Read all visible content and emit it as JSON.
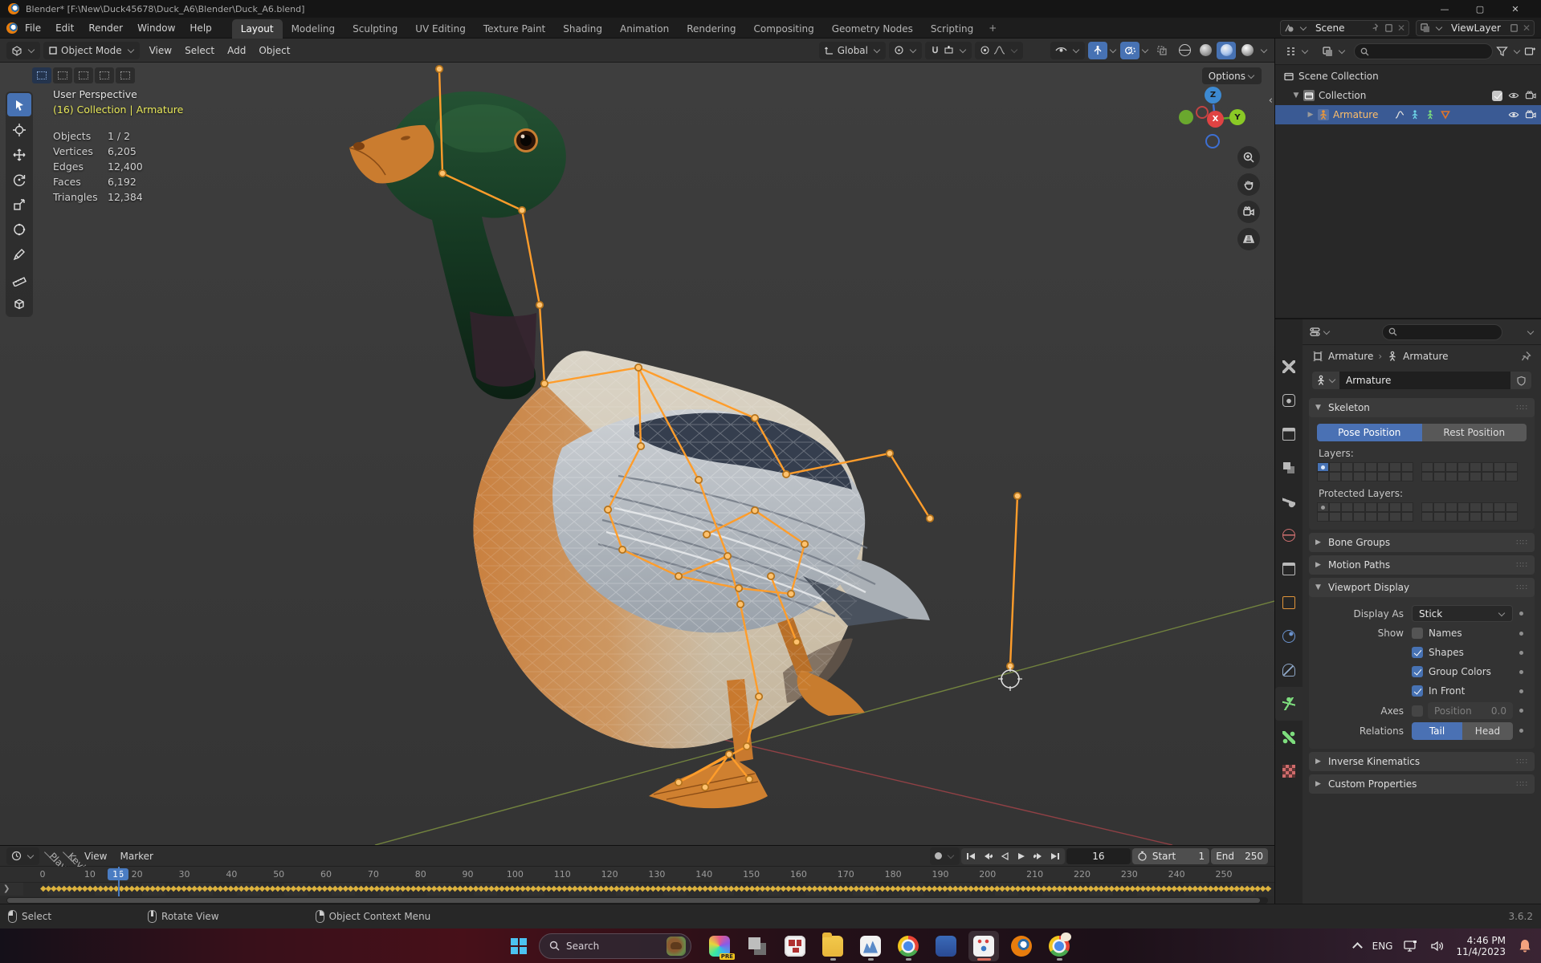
{
  "window": {
    "title": "Blender* [F:\\New\\Duck45678\\Duck_A6\\Blender\\Duck_A6.blend]",
    "minimize": "—",
    "maximize": "▢",
    "close": "✕"
  },
  "topbar": {
    "menus": [
      {
        "label": "File"
      },
      {
        "label": "Edit"
      },
      {
        "label": "Render"
      },
      {
        "label": "Window"
      },
      {
        "label": "Help"
      }
    ],
    "workspaces": [
      {
        "label": "Layout",
        "active": true
      },
      {
        "label": "Modeling"
      },
      {
        "label": "Sculpting"
      },
      {
        "label": "UV Editing"
      },
      {
        "label": "Texture Paint"
      },
      {
        "label": "Shading"
      },
      {
        "label": "Animation"
      },
      {
        "label": "Rendering"
      },
      {
        "label": "Compositing"
      },
      {
        "label": "Geometry Nodes"
      },
      {
        "label": "Scripting"
      }
    ],
    "add_tab": "+",
    "scene": "Scene",
    "view_layer": "ViewLayer"
  },
  "viewport_header": {
    "mode": "Object Mode",
    "menus": [
      {
        "label": "View"
      },
      {
        "label": "Select"
      },
      {
        "label": "Add"
      },
      {
        "label": "Object"
      }
    ],
    "orientation": "Global",
    "options": "Options"
  },
  "viewport": {
    "overlay": {
      "view": "User Perspective",
      "context": "(16) Collection | Armature",
      "stats": [
        {
          "label": "Objects",
          "value": "1 / 2"
        },
        {
          "label": "Vertices",
          "value": "6,205"
        },
        {
          "label": "Edges",
          "value": "12,400"
        },
        {
          "label": "Faces",
          "value": "6,192"
        },
        {
          "label": "Triangles",
          "value": "12,384"
        }
      ]
    },
    "gizmo": {
      "x": "X",
      "y": "Y",
      "z": "Z"
    }
  },
  "outliner": {
    "scene_collection": "Scene Collection",
    "collection": "Collection",
    "armature": "Armature"
  },
  "properties": {
    "tabs": [
      {
        "icon": "tool-icon"
      },
      {
        "icon": "render-icon"
      },
      {
        "icon": "output-icon"
      },
      {
        "icon": "view-layer-icon"
      },
      {
        "icon": "scene-icon"
      },
      {
        "icon": "world-icon"
      },
      {
        "icon": "collection-icon"
      },
      {
        "icon": "object-icon"
      },
      {
        "icon": "physics-icon"
      },
      {
        "icon": "constraints-icon"
      },
      {
        "icon": "object-data-icon",
        "active": true
      },
      {
        "icon": "bone-icon"
      },
      {
        "icon": "texture-icon"
      }
    ],
    "breadcrumb": {
      "object": "Armature",
      "separator": "›",
      "data": "Armature"
    },
    "name_value": "Armature",
    "skeleton": {
      "title": "Skeleton",
      "pose": "Pose Position",
      "rest": "Rest Position",
      "layers_label": "Layers:",
      "protected_label": "Protected Layers:"
    },
    "bone_groups": "Bone Groups",
    "motion_paths": "Motion Paths",
    "viewport_display": {
      "title": "Viewport Display",
      "display_as_label": "Display As",
      "display_as": "Stick",
      "show_label": "Show",
      "toggles": [
        {
          "label": "Names",
          "checked": false
        },
        {
          "label": "Shapes",
          "checked": true
        },
        {
          "label": "Group Colors",
          "checked": true
        },
        {
          "label": "In Front",
          "checked": true
        }
      ],
      "axes_label": "Axes",
      "position_placeholder": "Position",
      "position_value": "0.0",
      "relations_label": "Relations",
      "tail": "Tail",
      "head": "Head"
    },
    "inverse_kinematics": "Inverse Kinematics",
    "custom_properties": "Custom Properties"
  },
  "timeline": {
    "menus": [
      {
        "label": "Playback",
        "chev": true
      },
      {
        "label": "Keying",
        "chev": true
      },
      {
        "label": "View"
      },
      {
        "label": "Marker"
      }
    ],
    "ticks": [
      0,
      10,
      20,
      30,
      40,
      50,
      60,
      70,
      80,
      90,
      100,
      110,
      120,
      130,
      140,
      150,
      160,
      170,
      180,
      190,
      200,
      210,
      220,
      230,
      240,
      250
    ],
    "current_frame": "16",
    "current_frame_num": 16,
    "start_label": "Start",
    "start_value": "1",
    "end_label": "End",
    "end_value": "250",
    "keyframes": {
      "from": 0,
      "to": 250,
      "every_frame": true
    }
  },
  "statusbar": {
    "hints": [
      {
        "icon": "mouse-left-icon",
        "label": "Select"
      },
      {
        "icon": "mouse-middle-icon",
        "label": "Rotate View"
      },
      {
        "icon": "mouse-right-icon",
        "label": "Object Context Menu"
      }
    ],
    "version": "3.6.2"
  },
  "taskbar": {
    "search_label": "Search",
    "icons": [
      {
        "icon": "copilot-icon",
        "badge": "PRE"
      },
      {
        "icon": "taskview-icon"
      },
      {
        "icon": "tiles-icon"
      },
      {
        "icon": "folder-icon",
        "indicator": "dot"
      },
      {
        "icon": "photos-icon",
        "indicator": "dot"
      },
      {
        "icon": "chrome-icon",
        "indicator": "dot"
      },
      {
        "icon": "mapp-icon"
      },
      {
        "icon": "snip-icon",
        "indicator": "active"
      },
      {
        "icon": "blender-icon"
      },
      {
        "icon": "browser-icon",
        "indicator": "dot"
      }
    ],
    "tray": {
      "lang": "ENG",
      "time": "4:46 PM",
      "date": "11/4/2023"
    }
  }
}
